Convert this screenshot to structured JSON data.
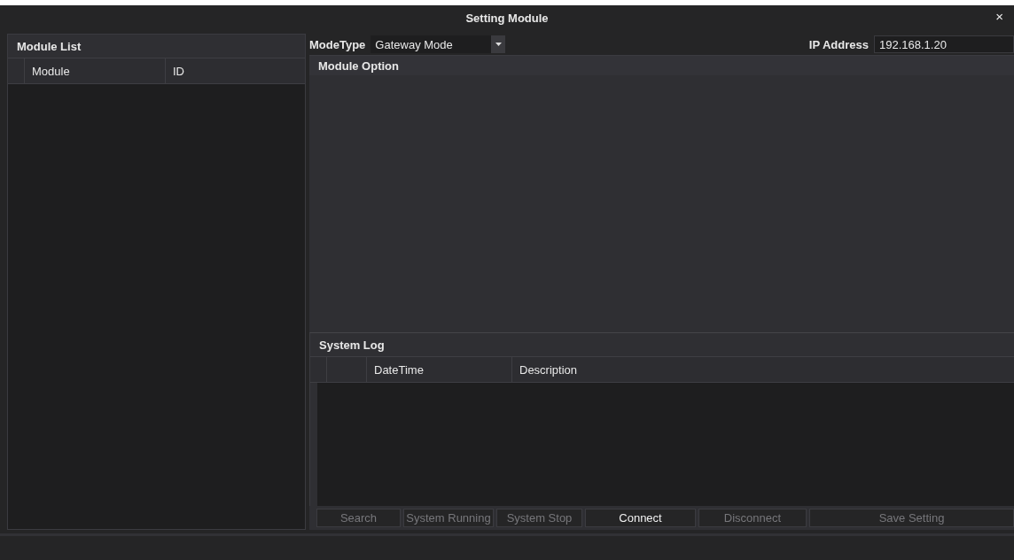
{
  "window": {
    "title": "Setting Module",
    "close": "×"
  },
  "module_list": {
    "title": "Module List",
    "columns": [
      "Module",
      "ID"
    ]
  },
  "mode_type": {
    "label": "ModeType",
    "value": "Gateway Mode"
  },
  "ip_address": {
    "label": "IP Address",
    "value": "192.168.1.20"
  },
  "module_option": {
    "title": "Module Option"
  },
  "system_log": {
    "title": "System Log",
    "columns": [
      "DateTime",
      "Description"
    ]
  },
  "buttons": [
    {
      "label": "Search",
      "disabled": true
    },
    {
      "label": "System Running",
      "disabled": true
    },
    {
      "label": "System Stop",
      "disabled": true
    },
    {
      "label": "Connect",
      "disabled": false
    },
    {
      "label": "Disconnect",
      "disabled": true
    },
    {
      "label": "Save Setting",
      "disabled": true
    }
  ]
}
